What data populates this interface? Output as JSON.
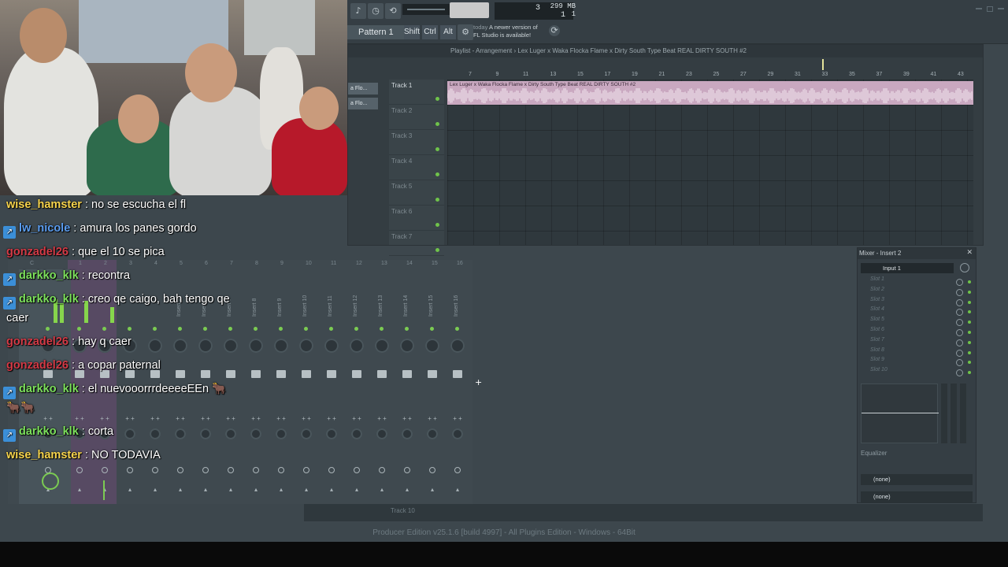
{
  "toolbar": {
    "pattern_label": "Pattern 1",
    "modifier_keys": [
      "Shift",
      "Ctrl",
      "Alt"
    ],
    "hint_line1": "A newer version of",
    "hint_prefix": "today",
    "hint_line2": "FL Studio is available!",
    "position_value": "3",
    "position_sub": "1",
    "memory": "299 MB",
    "memory_sub": "1"
  },
  "playlist": {
    "title": "Playlist - Arrangement › Lex Luger x Waka Flocka Flame x Dirty South Type Beat REAL DIRTY SOUTH #2",
    "picker_items": [
      "a Flo...",
      "a Flo..."
    ],
    "ruler": [
      "7",
      "9",
      "11",
      "13",
      "15",
      "17",
      "19",
      "21",
      "23",
      "25",
      "27",
      "29",
      "31",
      "33",
      "35",
      "37",
      "39",
      "41",
      "43"
    ],
    "tracks": [
      "Track 1",
      "Track 2",
      "Track 3",
      "Track 4",
      "Track 5",
      "Track 6",
      "Track 7"
    ],
    "clip_label": "Lex Luger x Waka Flocka Flame x Dirty South Type Beat REAL DIRTY SOUTH #2"
  },
  "mixer": {
    "ruler": [
      "C",
      "1",
      "2",
      "3",
      "4",
      "5",
      "6",
      "7",
      "8",
      "9",
      "10",
      "11",
      "12",
      "13",
      "14",
      "15",
      "16"
    ],
    "inserts": [
      "Insert 5",
      "Insert 6",
      "Insert 7",
      "Insert 8",
      "Insert 9",
      "Insert 10",
      "Insert 11",
      "Insert 12",
      "Insert 13",
      "Insert 14",
      "Insert 15",
      "Insert 16"
    ],
    "routing_symbol": "+ +"
  },
  "insert_panel": {
    "title": "Mixer - Insert 2",
    "input": "Input 1",
    "slots": [
      "Slot 1",
      "Slot 2",
      "Slot 3",
      "Slot 4",
      "Slot 5",
      "Slot 6",
      "Slot 7",
      "Slot 8",
      "Slot 9",
      "Slot 10"
    ],
    "eq_label": "Equalizer",
    "output_1": "(none)",
    "output_2": "(none)"
  },
  "status": {
    "track_label": "Track 10",
    "build_info": "Producer Edition v25.1.6 [build 4997] - All Plugins Edition - Windows - 64Bit"
  },
  "chat": [
    {
      "user": "wise_hamster",
      "text": "no se escucha el fl",
      "color": "#f7d44c",
      "badge": false
    },
    {
      "user": "lw_nicole",
      "text": "amura los panes gordo",
      "color": "#5b9df0",
      "badge": true
    },
    {
      "user": "gonzadel26",
      "text": "que el 10 se pica",
      "color": "#d43a46",
      "badge": false
    },
    {
      "user": "darkko_klk",
      "text": "recontra",
      "color": "#7ce05c",
      "badge": true
    },
    {
      "user": "darkko_klk",
      "text": "creo qe caigo, bah tengo qe",
      "color": "#7ce05c",
      "badge": true
    },
    {
      "user": "",
      "text": "caer",
      "color": "#ffffff",
      "badge": false
    },
    {
      "user": "gonzadel26",
      "text": "hay q caer",
      "color": "#d43a46",
      "badge": false
    },
    {
      "user": "gonzadel26",
      "text": "a copar paternal",
      "color": "#d43a46",
      "badge": false
    },
    {
      "user": "darkko_klk",
      "text": "el nuevooorrrdeeeeEEn 🐂",
      "color": "#7ce05c",
      "badge": true
    },
    {
      "user": "",
      "text": "🐂🐂",
      "color": "#ffffff",
      "badge": false
    },
    {
      "user": "darkko_klk",
      "text": "corta",
      "color": "#7ce05c",
      "badge": true
    },
    {
      "user": "wise_hamster",
      "text": "NO TODAVIA",
      "color": "#f7d44c",
      "badge": false
    }
  ]
}
